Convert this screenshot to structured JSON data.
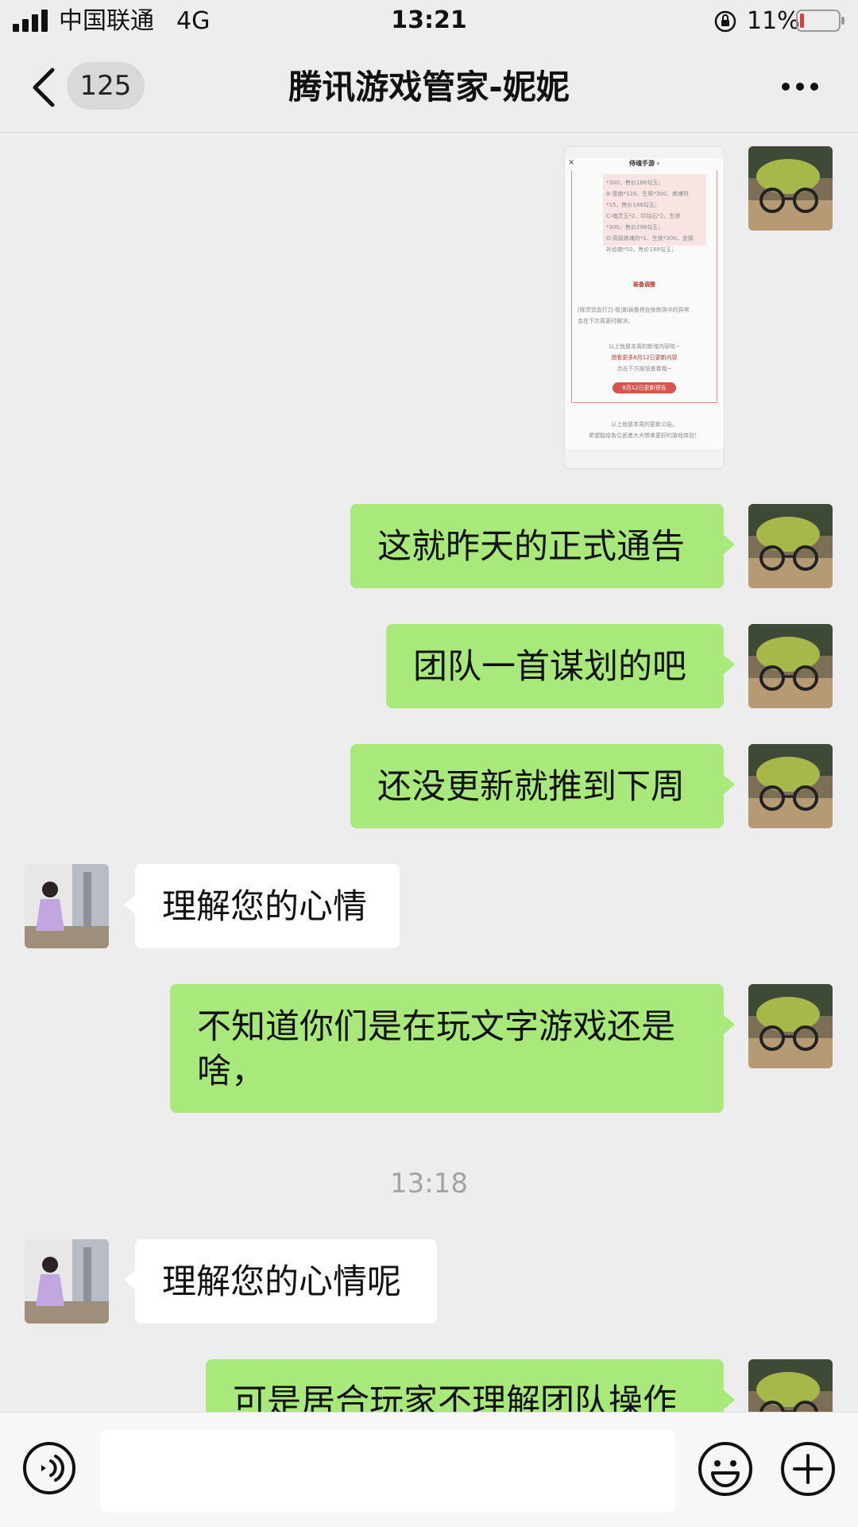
{
  "status_bar": {
    "carrier": "中国联通",
    "network": "4G",
    "time": "13:21",
    "battery": "11%"
  },
  "nav": {
    "unread_count": "125",
    "title": "腾讯游戏管家-妮妮"
  },
  "image_message": {
    "header": "侍魂手游 ›",
    "lines": [
      "*300，售价188勾玉；",
      "B-菠南*128、生铁*300、炼魂符",
      "*15，售价188勾玉；",
      "C-魂灵玉*2、印铭石*2、生铁",
      "*300，售价298勾玉；",
      "D-高级炼魂符*1、生铁*300、金锦",
      "补给箱*50，售价188勾玉；"
    ],
    "section_title": "装备调整",
    "body_lines": [
      "[辉灵饮血打刀·极]新装备将在修炼场中的异常",
      "会在下次周更时解决。",
      "以上就是本周的新增内容啦~",
      "想看更多8月12日更新内容",
      "点击下方按钮查看哦~"
    ],
    "button": "8月12日更新预告",
    "footer_lines": [
      "以上就是本周的更新公告。",
      "希望能给各位武者大大带来更好的游戏体验！"
    ]
  },
  "messages": [
    {
      "from": "me",
      "text": "这就昨天的正式通告"
    },
    {
      "from": "me",
      "text": "团队一首谋划的吧"
    },
    {
      "from": "me",
      "text": "还没更新就推到下周"
    },
    {
      "from": "them",
      "text": "理解您的心情"
    },
    {
      "from": "me",
      "text": "不知道你们是在玩文字游戏还是啥，"
    },
    {
      "from": "them",
      "text": "理解您的心情呢"
    },
    {
      "from": "me",
      "text": "可是居合玩家不理解团队操作"
    }
  ],
  "time_divider": "13:18",
  "colors": {
    "background": "#ededed",
    "my_bubble": "#a9e97b",
    "their_bubble": "#ffffff",
    "battery_low": "#e53935"
  },
  "icons": {
    "back": "chevron-left-icon",
    "more": "more-dots-icon",
    "voice": "voice-icon",
    "emoji": "emoji-icon",
    "plus": "plus-circle-icon"
  }
}
